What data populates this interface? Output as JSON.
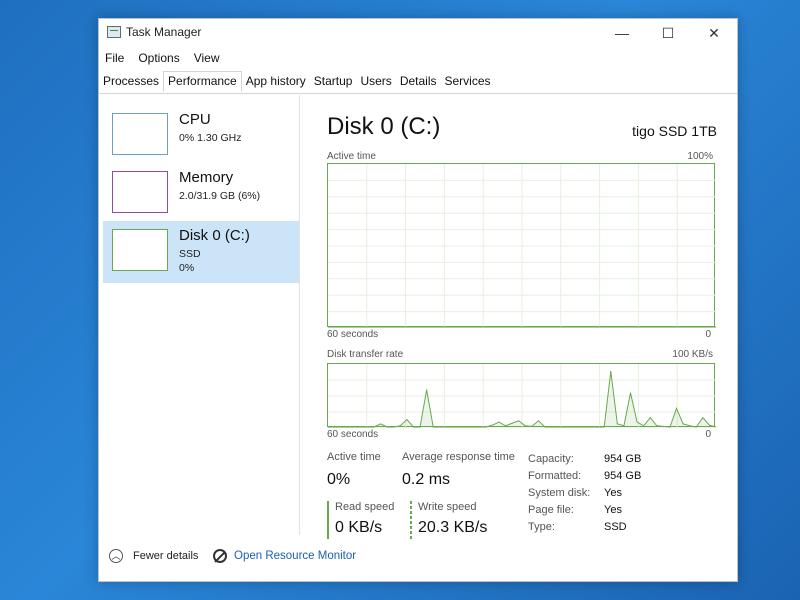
{
  "window": {
    "title": "Task Manager",
    "controls": {
      "minimize": "—",
      "maximize": "☐",
      "close": "✕"
    }
  },
  "menu": [
    "File",
    "Options",
    "View"
  ],
  "tabs": [
    "Processes",
    "Performance",
    "App history",
    "Startup",
    "Users",
    "Details",
    "Services"
  ],
  "active_tab": "Performance",
  "sidebar": {
    "items": [
      {
        "title": "CPU",
        "sub1": "0%  1.30 GHz",
        "sub2": ""
      },
      {
        "title": "Memory",
        "sub1": "2.0/31.9 GB (6%)",
        "sub2": ""
      },
      {
        "title": "Disk 0 (C:)",
        "sub1": "SSD",
        "sub2": "0%"
      }
    ],
    "selected_index": 2
  },
  "main": {
    "title": "Disk 0 (C:)",
    "model": "tigo SSD 1TB",
    "active_chart": {
      "label": "Active time",
      "max_label": "100%",
      "x_label": "60 seconds",
      "min_label": "0"
    },
    "transfer_chart": {
      "label": "Disk transfer rate",
      "max_label": "100 KB/s",
      "x_label": "60 seconds",
      "min_label": "0"
    },
    "stats": {
      "active_time_label": "Active time",
      "active_time_value": "0%",
      "avg_response_label": "Average response time",
      "avg_response_value": "0.2 ms",
      "read_speed_label": "Read speed",
      "read_speed_value": "0 KB/s",
      "write_speed_label": "Write speed",
      "write_speed_value": "20.3 KB/s"
    },
    "properties": [
      {
        "name": "Capacity:",
        "value": "954 GB"
      },
      {
        "name": "Formatted:",
        "value": "954 GB"
      },
      {
        "name": "System disk:",
        "value": "Yes"
      },
      {
        "name": "Page file:",
        "value": "Yes"
      },
      {
        "name": "Type:",
        "value": "SSD"
      }
    ]
  },
  "footer": {
    "fewer_details": "Fewer details",
    "resource_monitor": "Open Resource Monitor"
  },
  "colors": {
    "disk_accent": "#6aa84f",
    "cpu_accent": "#6e9ec8",
    "memory_accent": "#8e4c9a",
    "selected_bg": "#cce4f7",
    "link": "#1a5fb4"
  },
  "chart_data": [
    {
      "type": "area",
      "label": "Active time",
      "x_label": "60 seconds",
      "ylim": [
        0,
        100
      ],
      "values": [
        0,
        0,
        0,
        0,
        0,
        0,
        0,
        0,
        0,
        0,
        0,
        0,
        0,
        0,
        0,
        0,
        0,
        0,
        0,
        0,
        0,
        0,
        0,
        0,
        0,
        0,
        0,
        0,
        0,
        0,
        0,
        0,
        0,
        0,
        0,
        0,
        0,
        0,
        0,
        0,
        0,
        0,
        0,
        0,
        0,
        0,
        0,
        0,
        0,
        0,
        0,
        0,
        0,
        0,
        0,
        0,
        0,
        0,
        0,
        0
      ]
    },
    {
      "type": "line",
      "label": "Disk transfer rate",
      "x_label": "60 seconds",
      "ylim": [
        0,
        100
      ],
      "unit": "KB/s",
      "values": [
        0,
        0,
        0,
        0,
        0,
        0,
        0,
        0,
        5,
        0,
        0,
        2,
        12,
        0,
        0,
        60,
        0,
        0,
        0,
        0,
        0,
        0,
        0,
        0,
        0,
        3,
        8,
        2,
        6,
        10,
        2,
        1,
        10,
        0,
        0,
        0,
        0,
        0,
        0,
        0,
        0,
        0,
        0,
        90,
        5,
        2,
        55,
        8,
        2,
        15,
        2,
        1,
        0,
        30,
        5,
        2,
        0,
        15,
        3,
        0
      ]
    }
  ]
}
